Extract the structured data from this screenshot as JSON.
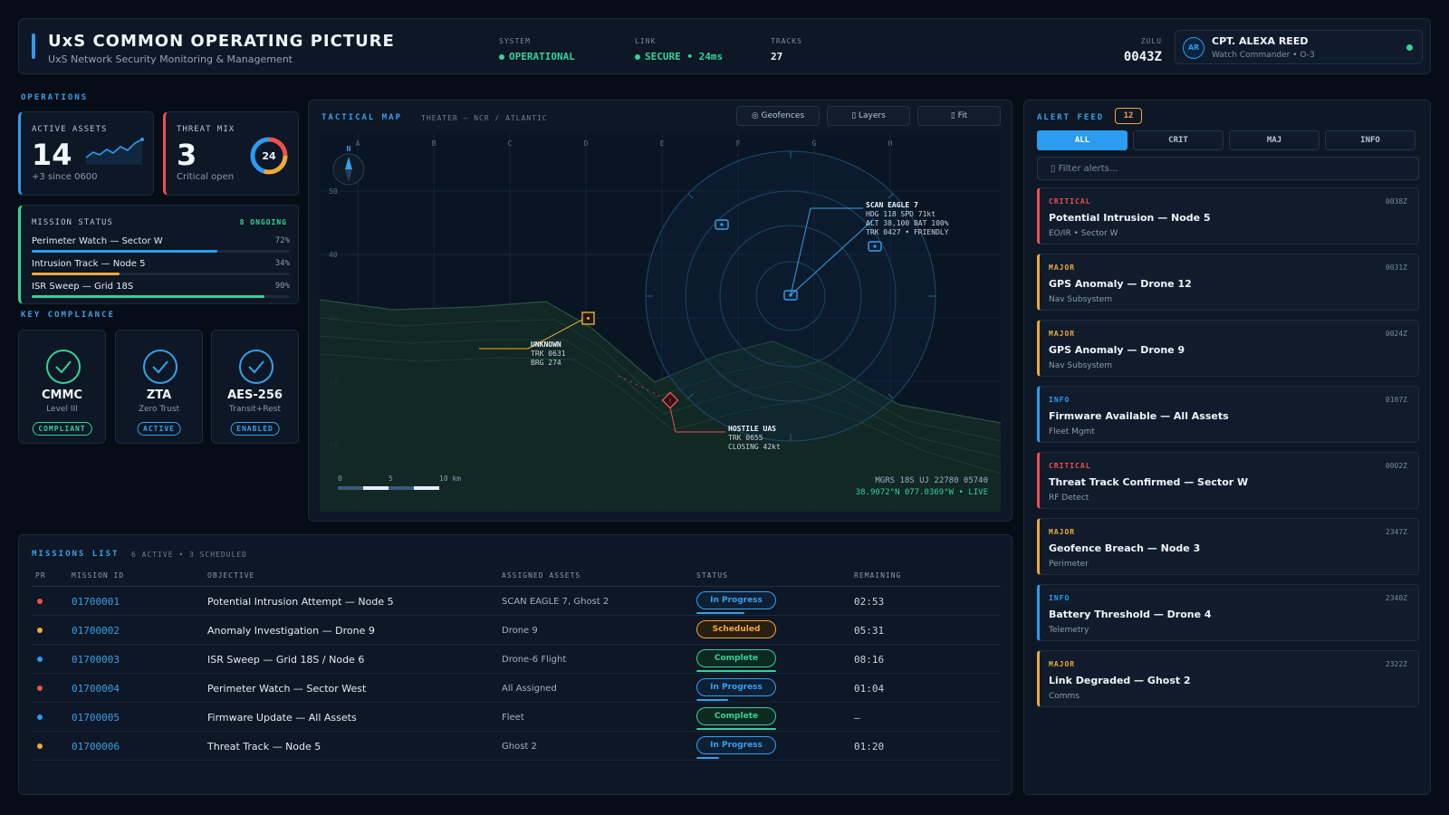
{
  "header": {
    "title": "UxS COMMON OPERATING PICTURE",
    "subtitle": "UxS Network Security Monitoring & Management",
    "system_label": "SYSTEM",
    "system_value": "OPERATIONAL",
    "link_label": "LINK",
    "link_value": "SECURE • 24ms",
    "tracks_label": "TRACKS",
    "tracks_value": "27",
    "zulu_label": "ZULU",
    "zulu_value": "0043Z",
    "user_initials": "AR",
    "user_name": "CPT. ALEXA REED",
    "user_role": "Watch Commander • O-3"
  },
  "operations": {
    "label": "OPERATIONS",
    "active_assets": {
      "label": "ACTIVE ASSETS",
      "value": "14",
      "sub": "+3 since 0600"
    },
    "threat_mix": {
      "label": "THREAT MIX",
      "value": "3",
      "sub": "Critical open",
      "donut_value": "24"
    },
    "mission_status": {
      "label": "MISSION STATUS",
      "ongoing": "8 ONGOING",
      "rows": [
        {
          "name": "Perimeter Watch — Sector W",
          "pct": "72%",
          "value": 0.72,
          "color": "#2b9cf0"
        },
        {
          "name": "Intrusion Track — Node 5",
          "pct": "34%",
          "value": 0.34,
          "color": "#f0a93a"
        },
        {
          "name": "ISR Sweep — Grid 18S",
          "pct": "90%",
          "value": 0.9,
          "color": "#34d399"
        }
      ]
    }
  },
  "compliance": {
    "label": "KEY COMPLIANCE",
    "items": [
      {
        "title": "CMMC",
        "sub": "Level III",
        "badge": "COMPLIANT",
        "color": "#34d399"
      },
      {
        "title": "ZTA",
        "sub": "Zero Trust",
        "badge": "ACTIVE",
        "color": "#3aa0e8"
      },
      {
        "title": "AES-256",
        "sub": "Transit+Rest",
        "badge": "ENABLED",
        "color": "#3aa0e8"
      }
    ]
  },
  "map": {
    "label": "TACTICAL MAP",
    "theater": "THEATER — NCR / ATLANTIC",
    "buttons": {
      "geofences": "◎ Geofences",
      "layers": "▯ Layers",
      "fit": "▯ Fit"
    },
    "compass": "N",
    "cols": [
      "A",
      "B",
      "C",
      "D",
      "E",
      "F",
      "G",
      "H"
    ],
    "rows": [
      "50",
      "40",
      "30",
      "20",
      "10"
    ],
    "scale": [
      "0",
      "5",
      "10 km"
    ],
    "tracks": {
      "scan_eagle": [
        "SCAN EAGLE 7",
        "HDG 118 SPD 71kt",
        "ALT 38,100 BAT 100%",
        "TRK 0427 • FRIENDLY"
      ],
      "unknown": [
        "UNKNOWN",
        "TRK 0631",
        "BRG 274"
      ],
      "hostile": [
        "HOSTILE UAS",
        "TRK 0655",
        "CLOSING 42kt"
      ]
    },
    "mgrs": "MGRS 18S UJ 22780 05740",
    "coords": "38.9072°N 077.0369°W • LIVE"
  },
  "alerts": {
    "label": "ALERT FEED",
    "count": "12",
    "tabs": [
      "ALL",
      "CRIT",
      "MAJ",
      "INFO"
    ],
    "filter_placeholder": "▯ Filter alerts...",
    "items": [
      {
        "severity": "CRITICAL",
        "time": "0038Z",
        "title": "Potential Intrusion — Node 5",
        "source": "EO/IR • Sector W",
        "color": "#ef4f4f"
      },
      {
        "severity": "MAJOR",
        "time": "0031Z",
        "title": "GPS Anomaly — Drone 12",
        "source": "Nav Subsystem",
        "color": "#f0a93a"
      },
      {
        "severity": "MAJOR",
        "time": "0024Z",
        "title": "GPS Anomaly — Drone 9",
        "source": "Nav Subsystem",
        "color": "#f0a93a"
      },
      {
        "severity": "INFO",
        "time": "0107Z",
        "title": "Firmware Available — All Assets",
        "source": "Fleet Mgmt",
        "color": "#2b9cf0"
      },
      {
        "severity": "CRITICAL",
        "time": "0002Z",
        "title": "Threat Track Confirmed — Sector W",
        "source": "RF Detect",
        "color": "#ef4f4f"
      },
      {
        "severity": "MAJOR",
        "time": "2347Z",
        "title": "Geofence Breach — Node 3",
        "source": "Perimeter",
        "color": "#f0a93a"
      },
      {
        "severity": "INFO",
        "time": "2340Z",
        "title": "Battery Threshold — Drone 4",
        "source": "Telemetry",
        "color": "#2b9cf0"
      },
      {
        "severity": "MAJOR",
        "time": "2322Z",
        "title": "Link Degraded — Ghost 2",
        "source": "Comms",
        "color": "#f0a93a"
      }
    ]
  },
  "missions": {
    "label": "MISSIONS LIST",
    "meta": "6 ACTIVE • 3 SCHEDULED",
    "headers": {
      "pr": "PR",
      "id": "MISSION ID",
      "objective": "OBJECTIVE",
      "assets": "ASSIGNED ASSETS",
      "status": "STATUS",
      "remaining": "REMAINING"
    },
    "rows": [
      {
        "priority_color": "#ef4f4f",
        "id": "01700001",
        "objective": "Potential Intrusion Attempt — Node 5",
        "assets": "SCAN EAGLE 7, Ghost 2",
        "status": "In Progress",
        "status_class": "st-blue",
        "progress": 0.6,
        "remaining": "02:53"
      },
      {
        "priority_color": "#f0a93a",
        "id": "01700002",
        "objective": "Anomaly Investigation — Drone 9",
        "assets": "Drone 9",
        "status": "Scheduled",
        "status_class": "st-amber",
        "progress": 0,
        "remaining": "05:31"
      },
      {
        "priority_color": "#2b9cf0",
        "id": "01700003",
        "objective": "ISR Sweep — Grid 18S / Node 6",
        "assets": "Drone-6 Flight",
        "status": "Complete",
        "status_class": "st-green",
        "progress": 1,
        "remaining": "08:16"
      },
      {
        "priority_color": "#ef4f4f",
        "id": "01700004",
        "objective": "Perimeter Watch — Sector West",
        "assets": "All Assigned",
        "status": "In Progress",
        "status_class": "st-blue",
        "progress": 0.4,
        "remaining": "01:04"
      },
      {
        "priority_color": "#2b9cf0",
        "id": "01700005",
        "objective": "Firmware Update — All Assets",
        "assets": "Fleet",
        "status": "Complete",
        "status_class": "st-green",
        "progress": 1,
        "remaining": "—"
      },
      {
        "priority_color": "#f0a93a",
        "id": "01700006",
        "objective": "Threat Track — Node 5",
        "assets": "Ghost 2",
        "status": "In Progress",
        "status_class": "st-blue",
        "progress": 0.28,
        "remaining": "01:20"
      }
    ]
  }
}
